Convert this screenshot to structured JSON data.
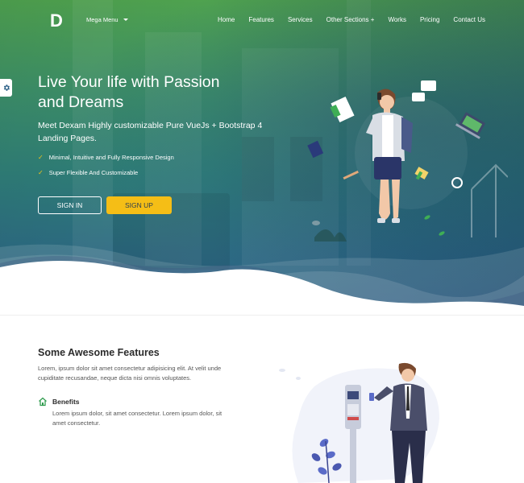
{
  "brand": {
    "logo_letter": "D"
  },
  "nav": {
    "mega_menu": "Mega Menu",
    "items": [
      {
        "label": "Home"
      },
      {
        "label": "Features"
      },
      {
        "label": "Services"
      },
      {
        "label": "Other Sections +"
      },
      {
        "label": "Works"
      },
      {
        "label": "Pricing"
      },
      {
        "label": "Contact Us"
      }
    ]
  },
  "hero": {
    "title_line1": "Live Your life with Passion",
    "title_line2": "and Dreams",
    "subtitle": "Meet Dexam Highly customizable Pure VueJs + Bootstrap 4 Landing Pages.",
    "features": [
      "Minimal, Intuitive and Fully Responsive Design",
      "Super Flexible And Customizable"
    ],
    "signin_label": "SIGN IN",
    "signup_label": "SIGN UP"
  },
  "features_section": {
    "title": "Some Awesome Features",
    "text": "Lorem, ipsum dolor sit amet consectetur adipisicing elit. At velit unde cupiditate recusandae, neque dicta nisi omnis voluptates.",
    "benefit": {
      "title": "Benefits",
      "text": "Lorem ipsum dolor, sit amet consectetur. Lorem ipsum dolor, sit amet consectetur."
    }
  },
  "colors": {
    "accent_yellow": "#f5be16",
    "hero_top_green": "#4fa24f",
    "hero_bottom_blue": "#2a5f86",
    "benefit_icon_green": "#2e9b4d"
  },
  "icons": {
    "settings_tab": "gear-icon",
    "benefit": "home-icon",
    "feature_bullet": "check-icon",
    "mega_menu": "caret-down-icon"
  }
}
